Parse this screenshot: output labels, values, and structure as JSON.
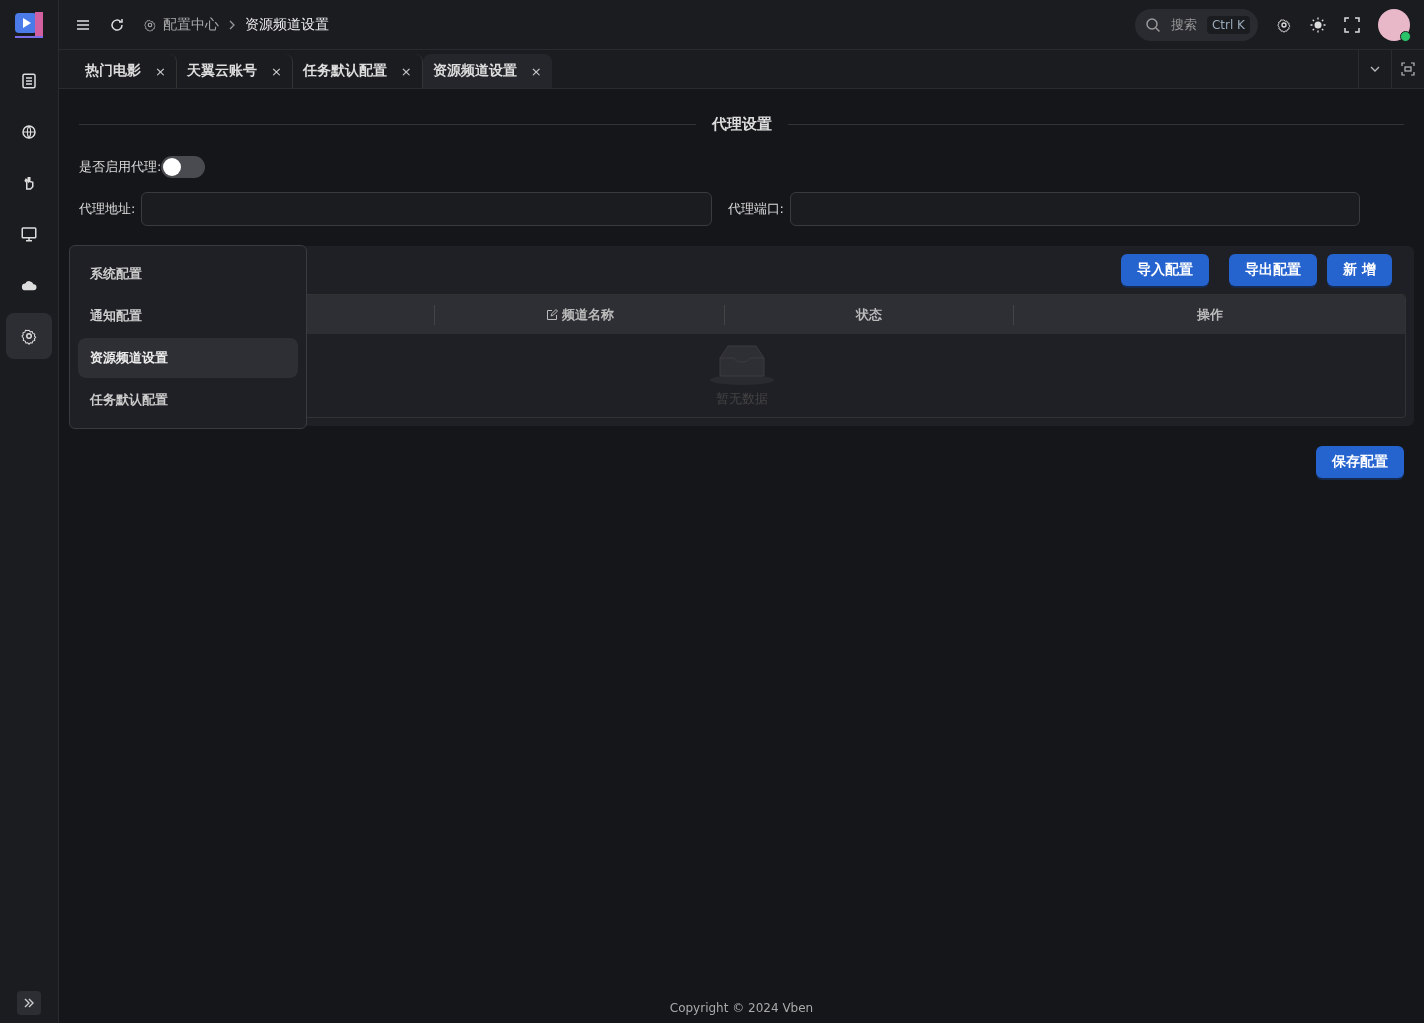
{
  "breadcrumb": [
    {
      "label": "配置中心"
    },
    {
      "label": "资源频道设置"
    }
  ],
  "search": {
    "placeholder": "搜索",
    "shortcut": "Ctrl K"
  },
  "sidebar": {
    "items": [
      {
        "selected": false
      },
      {
        "selected": false
      },
      {
        "selected": false
      },
      {
        "selected": false
      },
      {
        "selected": false
      },
      {
        "selected": true
      }
    ]
  },
  "tabs": [
    {
      "label": "热门电影",
      "close": "×",
      "selected": false
    },
    {
      "label": "天翼云账号",
      "close": "×",
      "selected": false
    },
    {
      "label": "任务默认配置",
      "close": "×",
      "selected": false
    },
    {
      "label": "资源频道设置",
      "close": "×",
      "selected": true
    }
  ],
  "section_title": "代理设置",
  "proxy_toggle": {
    "label": "是否启用代理:",
    "on": false
  },
  "fields": [
    {
      "label": "代理地址:"
    },
    {
      "label": "代理端口:"
    }
  ],
  "toolbar_buttons": [
    "导入配置",
    "导出配置",
    "新 增"
  ],
  "table": {
    "columns": [
      {},
      {
        "label": "频道名称"
      },
      {
        "label": "状态"
      },
      {
        "label": "操作"
      }
    ],
    "empty_text": "暂无数据"
  },
  "save_button": "保存配置",
  "menu": {
    "items": [
      {
        "label": "系统配置",
        "selected": false
      },
      {
        "label": "通知配置",
        "selected": false
      },
      {
        "label": "资源频道设置",
        "selected": true
      },
      {
        "label": "任务默认配置",
        "selected": false
      }
    ]
  },
  "footer": "Copyright © 2024 Vben"
}
